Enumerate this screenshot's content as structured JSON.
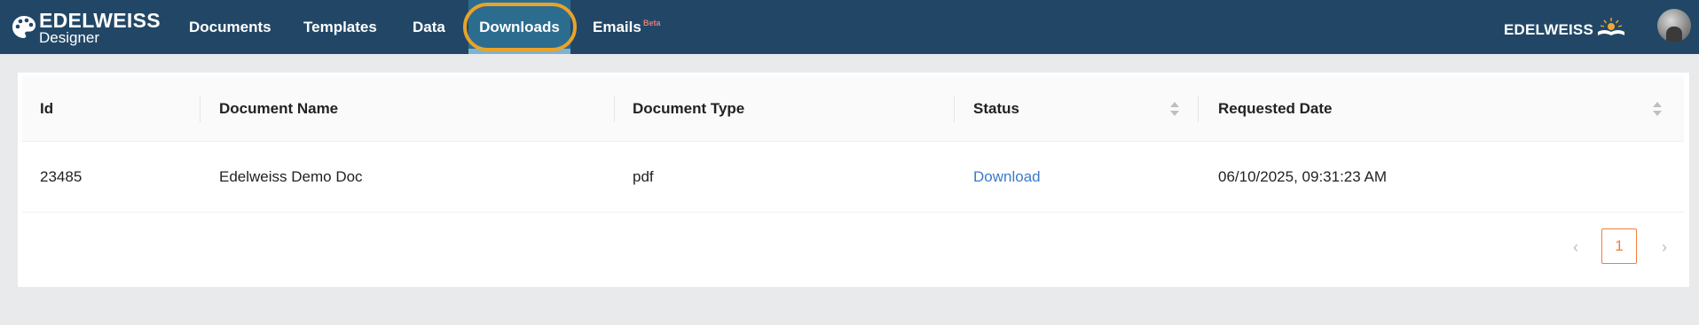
{
  "brand": {
    "name": "EDELWEISS",
    "subtitle": "Designer"
  },
  "nav": {
    "documents": "Documents",
    "templates": "Templates",
    "data": "Data",
    "downloads": "Downloads",
    "emails": "Emails",
    "emails_badge": "Beta",
    "active": "Downloads"
  },
  "right_logo": {
    "text": "EDELWEISS"
  },
  "table": {
    "columns": [
      "Id",
      "Document Name",
      "Document Type",
      "Status",
      "Requested Date"
    ],
    "rows": [
      {
        "id": "23485",
        "name": "Edelweiss Demo Doc",
        "type": "pdf",
        "status": "Download",
        "requested": "06/10/2025, 09:31:23 AM"
      }
    ]
  },
  "pagination": {
    "current": "1",
    "prev_icon": "chevron-left-icon",
    "next_icon": "chevron-right-icon"
  },
  "colors": {
    "navbar": "#224766",
    "active_tab": "#2c6c8f",
    "highlight_ring": "#e8a32a",
    "link": "#3b7ac9",
    "page_accent": "#f07d3c"
  }
}
